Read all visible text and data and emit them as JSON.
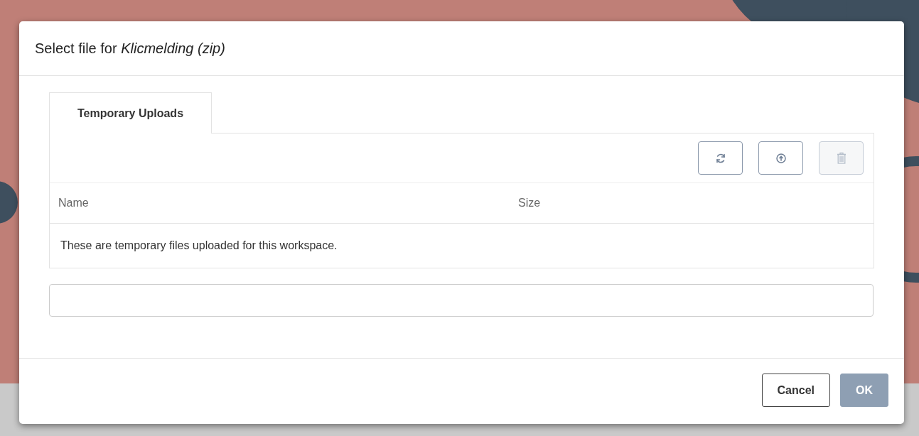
{
  "dialog": {
    "title": "Select file for *Klicmelding (zip)*",
    "tabs": [
      {
        "label": "Temporary Uploads",
        "selected": true
      }
    ],
    "toolbar": [
      {
        "kind": "refresh",
        "disabled": false
      },
      {
        "kind": "upload",
        "disabled": false
      },
      {
        "kind": "delete",
        "disabled": true
      }
    ],
    "table": {
      "columns": [
        "Name",
        "Size"
      ],
      "message": "These are temporary files uploaded for this workspace."
    },
    "buttons": [
      {
        "label": "Cancel",
        "kind": "secondary",
        "disabled": false
      },
      {
        "label": "OK",
        "kind": "primary",
        "disabled": true
      }
    ]
  }
}
